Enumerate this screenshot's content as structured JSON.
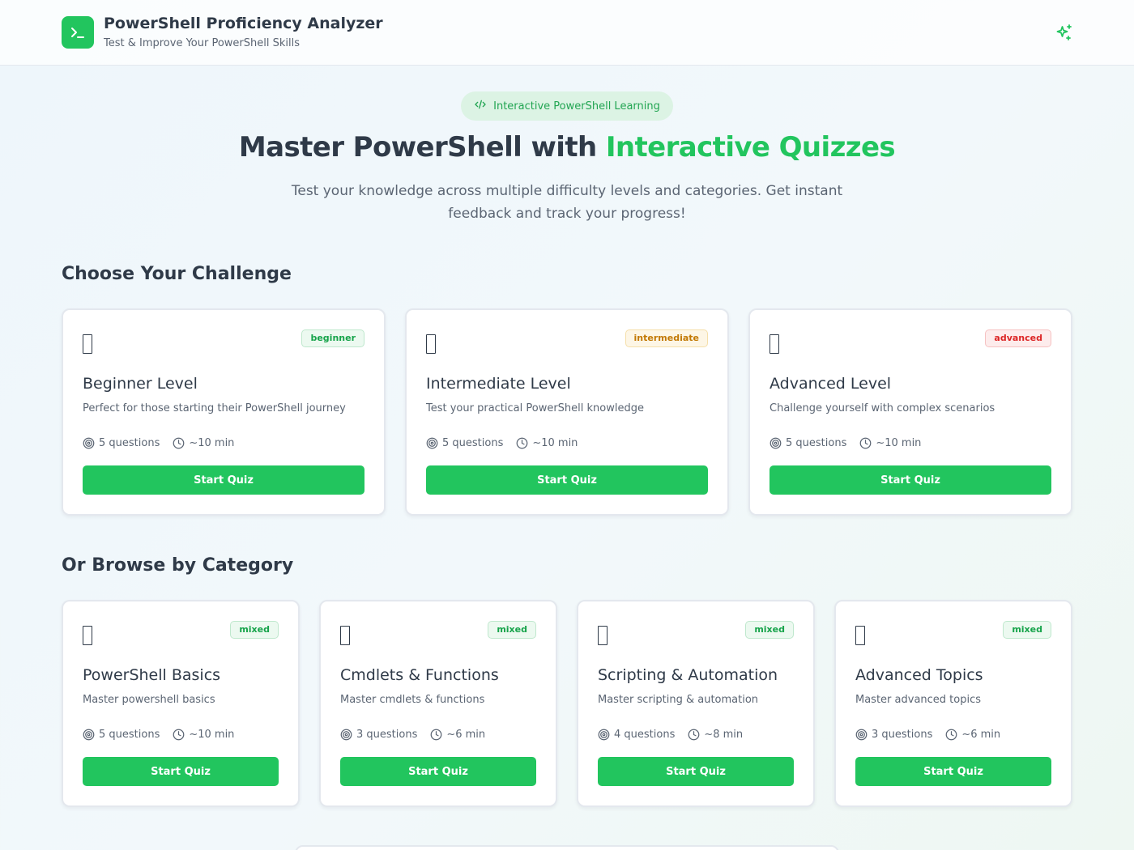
{
  "header": {
    "title": "PowerShell Proficiency Analyzer",
    "subtitle": "Test & Improve Your PowerShell Skills",
    "logo_icon": "terminal-icon",
    "action_icon": "sparkles-icon"
  },
  "hero": {
    "pill_label": "Interactive PowerShell Learning",
    "pill_icon": "code-icon",
    "title_main": "Master PowerShell with ",
    "title_accent": "Interactive Quizzes",
    "description": "Test your knowledge across multiple difficulty levels and categories. Get instant feedback and track your progress!"
  },
  "colors": {
    "accent": "#22c55e",
    "badge_beginner": "#16a34a",
    "badge_intermediate": "#c27803",
    "badge_advanced": "#dc2626"
  },
  "challenge": {
    "section_title": "Choose Your Challenge",
    "cards": [
      {
        "badge": "beginner",
        "title": "Beginner Level",
        "desc": "Perfect for those starting their PowerShell journey",
        "questions": "5 questions",
        "time": "~10 min",
        "button": "Start Quiz"
      },
      {
        "badge": "intermediate",
        "title": "Intermediate Level",
        "desc": "Test your practical PowerShell knowledge",
        "questions": "5 questions",
        "time": "~10 min",
        "button": "Start Quiz"
      },
      {
        "badge": "advanced",
        "title": "Advanced Level",
        "desc": "Challenge yourself with complex scenarios",
        "questions": "5 questions",
        "time": "~10 min",
        "button": "Start Quiz"
      }
    ]
  },
  "category": {
    "section_title": "Or Browse by Category",
    "cards": [
      {
        "badge": "mixed",
        "title": "PowerShell Basics",
        "desc": "Master powershell basics",
        "questions": "5 questions",
        "time": "~10 min",
        "button": "Start Quiz"
      },
      {
        "badge": "mixed",
        "title": "Cmdlets & Functions",
        "desc": "Master cmdlets & functions",
        "questions": "3 questions",
        "time": "~6 min",
        "button": "Start Quiz"
      },
      {
        "badge": "mixed",
        "title": "Scripting & Automation",
        "desc": "Master scripting & automation",
        "questions": "4 questions",
        "time": "~8 min",
        "button": "Start Quiz"
      },
      {
        "badge": "mixed",
        "title": "Advanced Topics",
        "desc": "Master advanced topics",
        "questions": "3 questions",
        "time": "~6 min",
        "button": "Start Quiz"
      }
    ]
  }
}
